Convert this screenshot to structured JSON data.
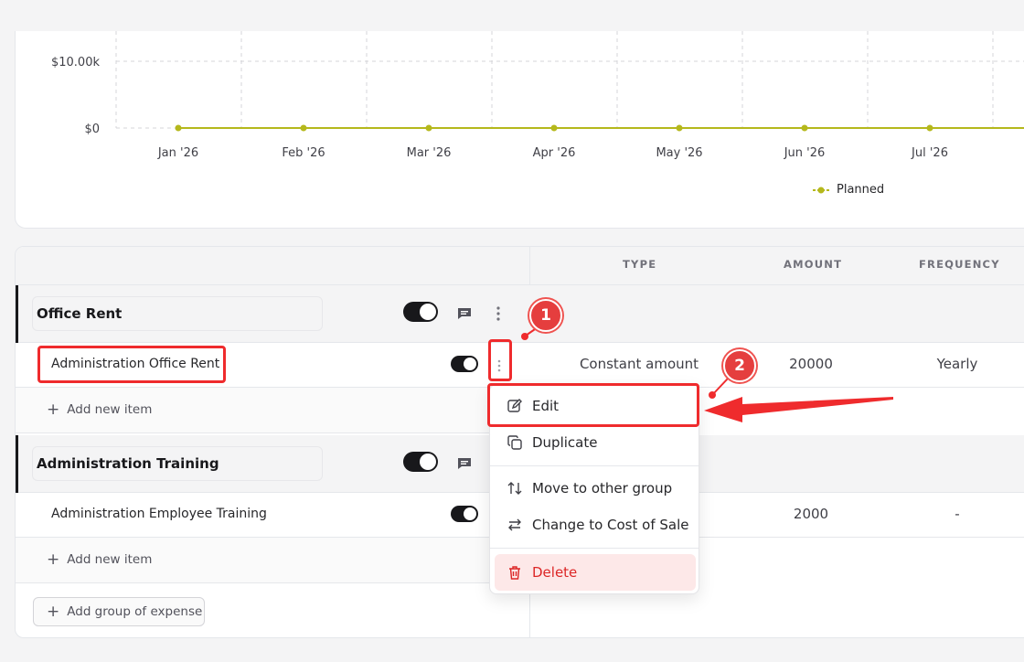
{
  "chart_data": {
    "type": "line",
    "categories": [
      "Jan '26",
      "Feb '26",
      "Mar '26",
      "Apr '26",
      "May '26",
      "Jun '26",
      "Jul '26"
    ],
    "y_tick_labels": [
      "$10.00k",
      "$0"
    ],
    "y_ticks": [
      10000,
      0
    ],
    "series": [
      {
        "name": "Planned",
        "values": [
          0,
          0,
          0,
          0,
          0,
          0,
          0
        ],
        "color": "#b5b81c"
      }
    ],
    "grid": true,
    "legend_position": "bottom-right"
  },
  "table": {
    "columns": [
      "TYPE",
      "AMOUNT",
      "FREQUENCY"
    ],
    "groups": [
      {
        "name": "Office Rent",
        "items": [
          {
            "name": "Administration Office Rent",
            "type": "Constant amount",
            "amount": "20000",
            "frequency": "Yearly"
          }
        ],
        "add_item_label": "Add new item"
      },
      {
        "name": "Administration Training",
        "items": [
          {
            "name": "Administration Employee Training",
            "type": "",
            "amount": "2000",
            "frequency": "-"
          }
        ],
        "add_item_label": "Add new item"
      }
    ],
    "add_group_label": "Add group of expense"
  },
  "menu": {
    "items": [
      "Edit",
      "Duplicate",
      "Move to other group",
      "Change to Cost of Sale",
      "Delete"
    ],
    "danger_color": "#dc2626"
  },
  "annotations": {
    "badge1": "1",
    "badge2": "2",
    "color": "#ef2b2d"
  }
}
